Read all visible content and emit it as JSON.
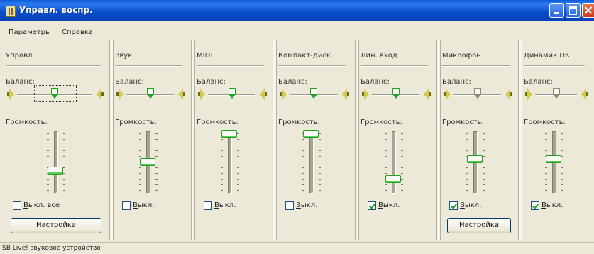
{
  "window": {
    "title": "Управл. воспр."
  },
  "menu": [
    {
      "accel": "П",
      "rest": "араметры"
    },
    {
      "accel": "С",
      "rest": "правка"
    }
  ],
  "channels": [
    {
      "name": "Управл.",
      "balance_label": "Баланс:",
      "volume_label": "Громкость:",
      "balance": 0.5,
      "volume": 0.35,
      "mute_label_accel": "В",
      "mute_label_rest": "ыкл. все",
      "muted": false,
      "has_button": true,
      "button_accel": "Н",
      "button_rest": "астройка",
      "focused": true
    },
    {
      "name": "Звук",
      "balance_label": "Баланс:",
      "volume_label": "Громкость:",
      "balance": 0.5,
      "volume": 0.5,
      "mute_label_accel": "В",
      "mute_label_rest": "ыкл.",
      "muted": false,
      "has_button": false
    },
    {
      "name": "MIDI",
      "balance_label": "Баланс:",
      "volume_label": "Громкость:",
      "balance": 0.5,
      "volume": 1.0,
      "mute_label_accel": "В",
      "mute_label_rest": "ыкл.",
      "muted": false,
      "has_button": false
    },
    {
      "name": "Компакт-диск",
      "balance_label": "Баланс:",
      "volume_label": "Громкость:",
      "balance": 0.5,
      "volume": 1.0,
      "mute_label_accel": "В",
      "mute_label_rest": "ыкл.",
      "muted": false,
      "has_button": false
    },
    {
      "name": "Лин. вход",
      "balance_label": "Баланс:",
      "volume_label": "Громкость:",
      "balance": 0.5,
      "volume": 0.2,
      "mute_label_accel": "В",
      "mute_label_rest": "ыкл.",
      "muted": true,
      "has_button": false
    },
    {
      "name": "Микрофон",
      "balance_label": "Баланс:",
      "volume_label": "Громкость:",
      "balance": 0.5,
      "volume": 0.55,
      "mute_label_accel": "В",
      "mute_label_rest": "ыкл.",
      "muted": true,
      "has_button": true,
      "button_accel": "Н",
      "button_rest": "астройка",
      "disabled_balance": true
    },
    {
      "name": "Динамик ПК",
      "balance_label": "Баланс:",
      "volume_label": "Громкость:",
      "balance": 0.5,
      "volume": 0.55,
      "mute_label_accel": "В",
      "mute_label_rest": "ыкл.",
      "muted": true,
      "has_button": false,
      "disabled_balance": true
    }
  ],
  "status": "SB Live! звуковое устройство"
}
